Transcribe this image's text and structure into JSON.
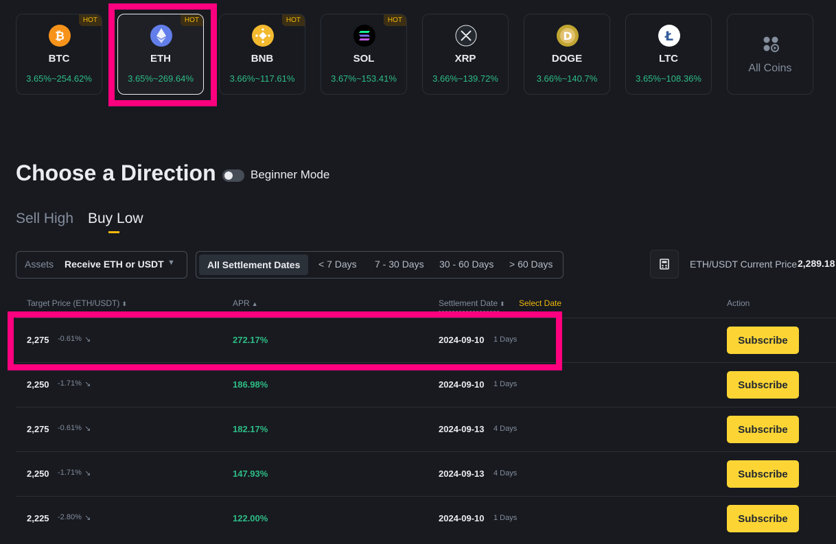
{
  "coins": [
    {
      "name": "BTC",
      "apr": "3.65%~254.62%",
      "hot": "HOT",
      "icon": "bitcoin-icon",
      "color": "#f7931a"
    },
    {
      "name": "ETH",
      "apr": "3.65%~269.64%",
      "hot": "HOT",
      "icon": "ethereum-icon",
      "color": "#627eea"
    },
    {
      "name": "BNB",
      "apr": "3.66%~117.61%",
      "hot": "HOT",
      "icon": "bnb-icon",
      "color": "#f3ba2f"
    },
    {
      "name": "SOL",
      "apr": "3.67%~153.41%",
      "hot": "HOT",
      "icon": "solana-icon",
      "color": "#000000"
    },
    {
      "name": "XRP",
      "apr": "3.66%~139.72%",
      "icon": "xrp-icon",
      "color": "#23292f"
    },
    {
      "name": "DOGE",
      "apr": "3.66%~140.7%",
      "icon": "dogecoin-icon",
      "color": "#c2a633"
    },
    {
      "name": "LTC",
      "apr": "3.65%~108.36%",
      "icon": "litecoin-icon",
      "color": "#ffffff"
    }
  ],
  "all_coins_label": "All Coins",
  "selected_coin": "ETH",
  "section_title": "Choose a Direction",
  "beginner_mode": {
    "label": "Beginner Mode",
    "enabled": false
  },
  "tabs": [
    {
      "label": "Sell High",
      "active": false
    },
    {
      "label": "Buy Low",
      "active": true
    }
  ],
  "assets": {
    "label": "Assets",
    "value": "Receive ETH or USDT"
  },
  "date_filters": [
    {
      "label": "All Settlement Dates",
      "selected": true
    },
    {
      "label": "< 7 Days"
    },
    {
      "label": "7 - 30 Days"
    },
    {
      "label": "30 - 60 Days"
    },
    {
      "label": "> 60 Days"
    }
  ],
  "price_info": {
    "label": "ETH/USDT Current Price",
    "value": "2,289.18"
  },
  "table": {
    "headers": {
      "target": "Target Price (ETH/USDT)",
      "apr": "APR",
      "settlement": "Settlement Date",
      "select_date": "Select Date",
      "action": "Action"
    },
    "rows": [
      {
        "price": "2,275",
        "pct": "-0.61%",
        "apr": "272.17%",
        "date": "2024-09-10",
        "days": "1 Days",
        "action": "Subscribe"
      },
      {
        "price": "2,250",
        "pct": "-1.71%",
        "apr": "186.98%",
        "date": "2024-09-10",
        "days": "1 Days",
        "action": "Subscribe"
      },
      {
        "price": "2,275",
        "pct": "-0.61%",
        "apr": "182.17%",
        "date": "2024-09-13",
        "days": "4 Days",
        "action": "Subscribe"
      },
      {
        "price": "2,250",
        "pct": "-1.71%",
        "apr": "147.93%",
        "date": "2024-09-13",
        "days": "4 Days",
        "action": "Subscribe"
      },
      {
        "price": "2,225",
        "pct": "-2.80%",
        "apr": "122.00%",
        "date": "2024-09-10",
        "days": "1 Days",
        "action": "Subscribe"
      }
    ]
  },
  "colors": {
    "accent": "#f0b90b",
    "positive": "#2ebd85",
    "highlight": "#ff007f",
    "button": "#fcd535"
  }
}
